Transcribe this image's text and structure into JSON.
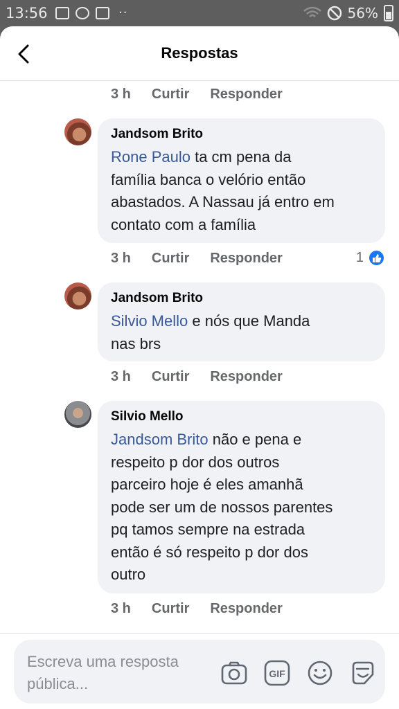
{
  "status_bar": {
    "time": "13:56",
    "battery": "56%"
  },
  "header": {
    "title": "Respostas"
  },
  "actions": {
    "like": "Curtir",
    "reply": "Responder"
  },
  "comments": [
    {
      "time": "3 h"
    },
    {
      "author": "Jandsom Brito",
      "mention": "Rone Paulo",
      "text": " ta cm pena da\nfamília banca o velório então\nabastados. A Nassau já entro em\ncontato com a família",
      "time": "3 h",
      "reactions": "1"
    },
    {
      "author": "Jandsom Brito",
      "mention": "Silvio Mello",
      "text": " e nós que Manda\nnas brs",
      "time": "3 h"
    },
    {
      "author": "Silvio Mello",
      "mention": "Jandsom Brito",
      "text": "  não e pena e\nrespeito p dor dos outros\nparceiro hoje é eles amanhã\npode ser um de nossos parentes\npq tamos sempre na estrada\nentão é só respeito p dor dos\noutro",
      "time": "3 h"
    }
  ],
  "composer": {
    "placeholder": "Escreva uma resposta pública..."
  },
  "icons": {
    "back": "chevron-left-icon",
    "camera": "camera-icon",
    "gif": "gif-icon",
    "emoji": "smiley-icon",
    "sticker": "sticker-icon",
    "like": "thumbs-up-icon"
  },
  "colors": {
    "mention": "#385898",
    "like": "#1877f2",
    "bubble": "#f0f2f5"
  }
}
